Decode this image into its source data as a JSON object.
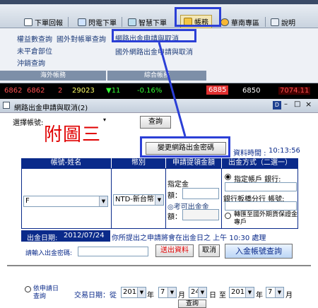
{
  "toolbar": {
    "items": [
      "下單回報",
      "閃電下單",
      "智慧下單",
      "帳務",
      "華南專區",
      "說明"
    ]
  },
  "menu": {
    "left_items": [
      "權益數查詢",
      "國外對帳單查詢",
      "未平倉部位",
      "沖銷查詢"
    ],
    "right_items": [
      "網路出金申請與取消",
      "國外網路出金申請與取消"
    ],
    "groups": [
      "海外帳務",
      "綜合帳務"
    ]
  },
  "ticker": {
    "values": [
      "6862",
      "6862",
      "2",
      "29023",
      "▼11",
      "-0.16%",
      "6885",
      "6850",
      "7074.11"
    ]
  },
  "window": {
    "title": "網路出金申請與取消(2)"
  },
  "form": {
    "account_label": "選擇帳號:",
    "query_button": "查詢",
    "annotation": "附圖三",
    "change_password_button": "變更網路出金密碼",
    "query_time_label": "資料時間 :",
    "query_time": "10:13:56",
    "headers": [
      "帳號-姓名",
      "幣別",
      "申請提領金額",
      "出金方式（二選一）"
    ],
    "account_value": "F",
    "currency_value": "NTD-新台幣",
    "amount_label_1": "指定金",
    "amount_label_2": "額：",
    "reference_label": "◎考可出金金",
    "reference_label_2": "額：",
    "method_1": "指定帳戶 銀行:",
    "method_1_sub": "銀行板橋分行  帳號:",
    "method_2": "轉匯至國外期貨保證金專戶",
    "withdraw_date_label": "出金日期:",
    "withdraw_date": "2012/07/24",
    "notice": "你所提出之申請將會在出金日之 上午 10:30 處理",
    "password_label": "請輸入出金密碼:",
    "submit_button": "送出資料",
    "cancel_button": "取消",
    "deposit_query_button": "入金帳號查詢",
    "query_option": "依申請日查詢",
    "trade_date_label": "交易日期：從",
    "year_1": "2012",
    "month_1": "7",
    "day_1": "24",
    "year_2": "2012",
    "month_2": "7",
    "year_unit": "年",
    "month_unit": "月",
    "day_unit": "日",
    "to_label": "至",
    "query_button_2": "查詢"
  },
  "colors": {
    "header_blue": "#0a2a8a",
    "highlight": "#2b3fd6",
    "annotation_red": "#e00000"
  }
}
